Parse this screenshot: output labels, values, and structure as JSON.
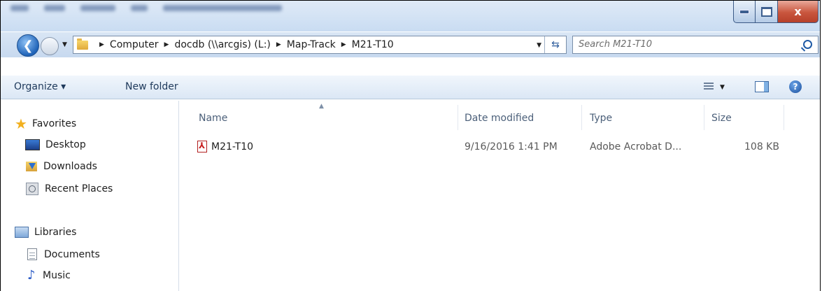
{
  "window": {
    "controls": {
      "minimize": "–",
      "maximize": "□",
      "close": "x"
    }
  },
  "address_bar": {
    "crumbs": [
      "Computer",
      "docdb (\\\\arcgis) (L:)",
      "Map-Track",
      "M21-T10"
    ],
    "search_placeholder": "Search M21-T10"
  },
  "toolbar": {
    "organize_label": "Organize ▾",
    "new_folder_label": "New folder"
  },
  "nav": {
    "favorites": "Favorites",
    "desktop": "Desktop",
    "downloads": "Downloads",
    "recent_places": "Recent Places",
    "libraries": "Libraries",
    "documents": "Documents",
    "music": "Music"
  },
  "columns": {
    "name": "Name",
    "date_modified": "Date modified",
    "type": "Type",
    "size": "Size"
  },
  "files": [
    {
      "name": "M21-T10",
      "date": "9/16/2016 1:41 PM",
      "type": "Adobe Acrobat D...",
      "size": "108 KB",
      "icon": "pdf-icon"
    }
  ]
}
